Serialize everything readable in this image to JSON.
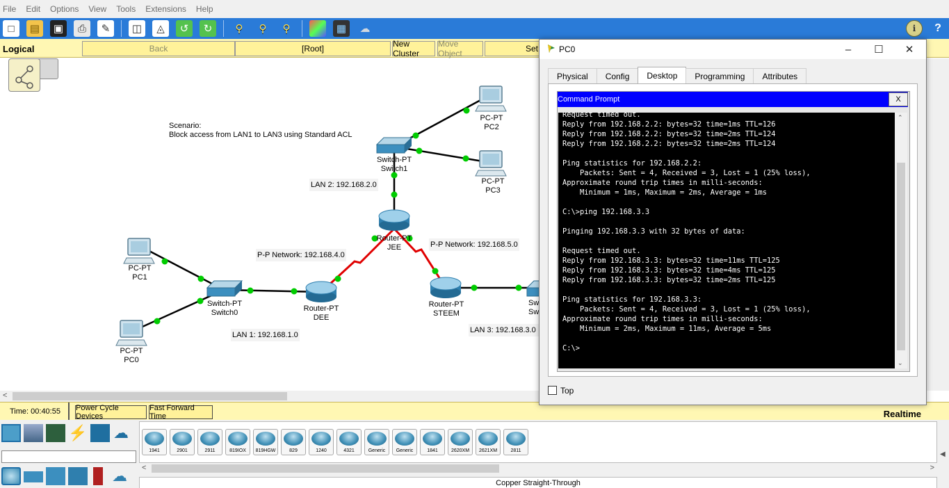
{
  "menu": [
    "File",
    "Edit",
    "Options",
    "View",
    "Tools",
    "Extensions",
    "Help"
  ],
  "logical_bar": {
    "mode": "Logical",
    "back": "Back",
    "root": "[Root]",
    "new_cluster": "New Cluster",
    "move_object": "Move Object",
    "set": "Set"
  },
  "topology": {
    "scenario_title": "Scenario:",
    "scenario_text": "Block access from LAN1 to LAN3 using Standard ACL",
    "devices": [
      {
        "id": "pc2",
        "type": "PC-PT",
        "name": "PC2"
      },
      {
        "id": "pc3",
        "type": "PC-PT",
        "name": "PC3"
      },
      {
        "id": "switch1",
        "type": "Switch-PT",
        "name": "Switch1"
      },
      {
        "id": "jee",
        "type": "Router-PT",
        "name": "JEE"
      },
      {
        "id": "pc1",
        "type": "PC-PT",
        "name": "PC1"
      },
      {
        "id": "switch0",
        "type": "Switch-PT",
        "name": "Switch0"
      },
      {
        "id": "dee",
        "type": "Router-PT",
        "name": "DEE"
      },
      {
        "id": "pc0",
        "type": "PC-PT",
        "name": "PC0"
      },
      {
        "id": "steem",
        "type": "Router-PT",
        "name": "STEEM"
      },
      {
        "id": "switch2",
        "type": "Sw",
        "name": "Sw"
      }
    ],
    "networks": {
      "lan2": "LAN 2: 192.168.2.0",
      "pp4": "P-P Network: 192.168.4.0",
      "pp5": "P-P Network: 192.168.5.0",
      "lan1": "LAN 1: 192.168.1.0",
      "lan3": "LAN 3: 192.168.3.0"
    }
  },
  "status": {
    "time": "Time: 00:40:55",
    "power_cycle": "Power Cycle Devices",
    "fast_forward": "Fast Forward Time",
    "mode": "Realtime"
  },
  "device_list": [
    "1941",
    "2901",
    "2911",
    "819IOX",
    "819HGW",
    "829",
    "1240",
    "4321",
    "Generic",
    "Generic",
    "1841",
    "2620XM",
    "2621XM",
    "2811"
  ],
  "connection_label": "Copper Straight-Through",
  "pc_window": {
    "title": "PC0",
    "tabs": [
      "Physical",
      "Config",
      "Desktop",
      "Programming",
      "Attributes"
    ],
    "active_tab": "Desktop",
    "cmd_title": "Command Prompt",
    "cmd_close": "X",
    "cmd_text": "Request timed out.\nReply from 192.168.2.2: bytes=32 time=1ms TTL=126\nReply from 192.168.2.2: bytes=32 time=2ms TTL=124\nReply from 192.168.2.2: bytes=32 time=2ms TTL=124\n\nPing statistics for 192.168.2.2:\n    Packets: Sent = 4, Received = 3, Lost = 1 (25% loss),\nApproximate round trip times in milli-seconds:\n    Minimum = 1ms, Maximum = 2ms, Average = 1ms\n\nC:\\>ping 192.168.3.3\n\nPinging 192.168.3.3 with 32 bytes of data:\n\nRequest timed out.\nReply from 192.168.3.3: bytes=32 time=11ms TTL=125\nReply from 192.168.3.3: bytes=32 time=4ms TTL=125\nReply from 192.168.3.3: bytes=32 time=2ms TTL=125\n\nPing statistics for 192.168.3.3:\n    Packets: Sent = 4, Received = 3, Lost = 1 (25% loss),\nApproximate round trip times in milli-seconds:\n    Minimum = 2ms, Maximum = 11ms, Average = 5ms\n\nC:\\>",
    "top_label": "Top"
  },
  "colors": {
    "toolbar": "#2a7bd8",
    "yellow_bar": "#fff7b3",
    "link_ok": "#00cc00",
    "serial_link": "#e00000",
    "cmd_bar": "#0000ff"
  }
}
